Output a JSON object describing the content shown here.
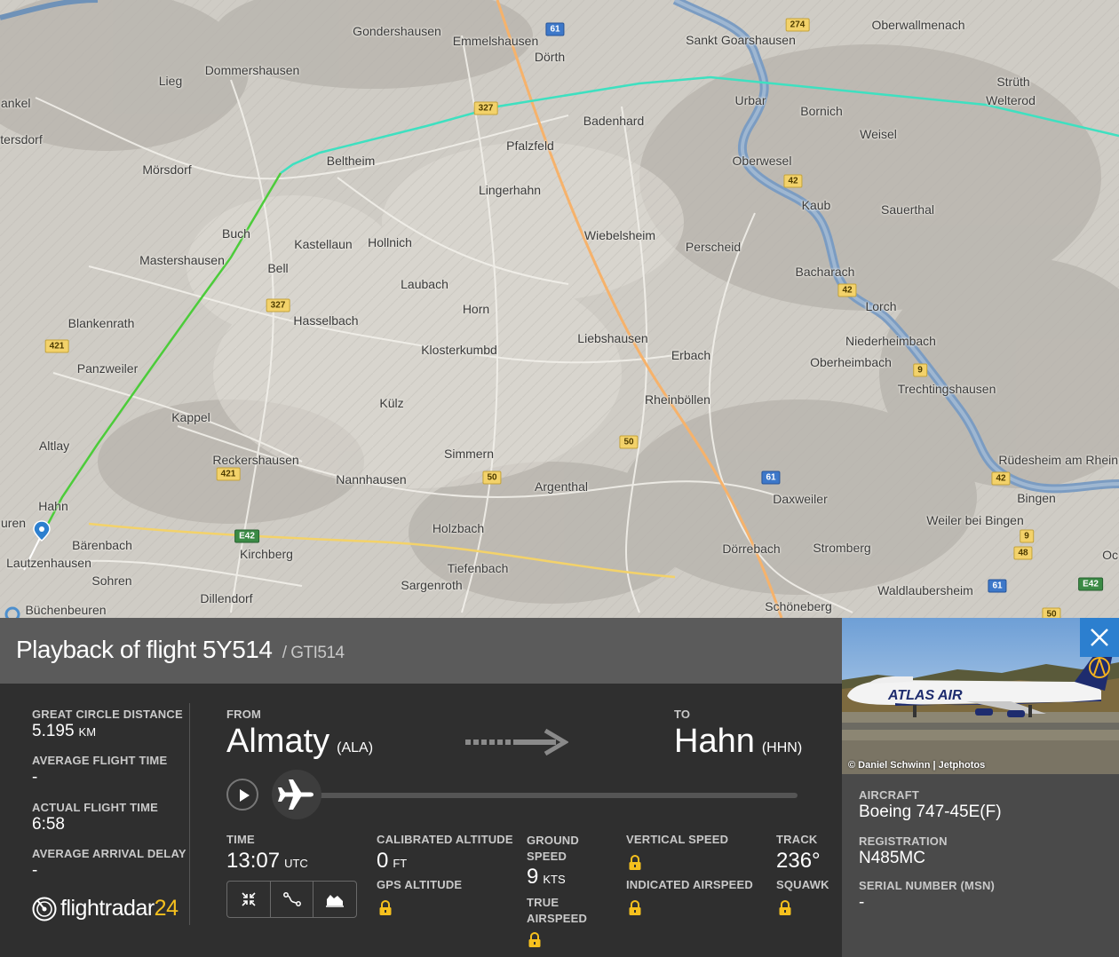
{
  "map": {
    "towns": [
      {
        "name": "Gondershausen"
      },
      {
        "name": "Emmelshausen"
      },
      {
        "name": "Dörth"
      },
      {
        "name": "Sankt Goarshausen"
      },
      {
        "name": "Oberwallmenach"
      },
      {
        "name": "Dommershausen"
      },
      {
        "name": "Lieg"
      },
      {
        "name": "ankel"
      },
      {
        "name": "tersdorf"
      },
      {
        "name": "Mörsdorf"
      },
      {
        "name": "Beltheim"
      },
      {
        "name": "Pfalzfeld"
      },
      {
        "name": "Badenhard"
      },
      {
        "name": "Urbar"
      },
      {
        "name": "Bornich"
      },
      {
        "name": "Strüth"
      },
      {
        "name": "Welterod"
      },
      {
        "name": "Weisel"
      },
      {
        "name": "Oberwesel"
      },
      {
        "name": "Lingerhahn"
      },
      {
        "name": "Kaub"
      },
      {
        "name": "Sauerthal"
      },
      {
        "name": "Buch"
      },
      {
        "name": "Kastellaun"
      },
      {
        "name": "Hollnich"
      },
      {
        "name": "Wiebelsheim"
      },
      {
        "name": "Perscheid"
      },
      {
        "name": "Mastershausen"
      },
      {
        "name": "Bell"
      },
      {
        "name": "Laubach"
      },
      {
        "name": "Bacharach"
      },
      {
        "name": "Lorch"
      },
      {
        "name": "Horn"
      },
      {
        "name": "Blankenrath"
      },
      {
        "name": "Hasselbach"
      },
      {
        "name": "Liebshausen"
      },
      {
        "name": "Niederheimbach"
      },
      {
        "name": "Klosterkumbd"
      },
      {
        "name": "Erbach"
      },
      {
        "name": "Oberheimbach"
      },
      {
        "name": "Panzweiler"
      },
      {
        "name": "Trechtingshausen"
      },
      {
        "name": "Külz"
      },
      {
        "name": "Rheinböllen"
      },
      {
        "name": "Kappel"
      },
      {
        "name": "Altlay"
      },
      {
        "name": "Simmern"
      },
      {
        "name": "Rüdesheim am Rhein"
      },
      {
        "name": "Reckershausen"
      },
      {
        "name": "Nannhausen"
      },
      {
        "name": "Argenthal"
      },
      {
        "name": "Daxweiler"
      },
      {
        "name": "Bingen"
      },
      {
        "name": "Hahn"
      },
      {
        "name": "uren"
      },
      {
        "name": "Holzbach"
      },
      {
        "name": "Weiler bei Bingen"
      },
      {
        "name": "Bärenbach"
      },
      {
        "name": "Kirchberg"
      },
      {
        "name": "Dörrebach"
      },
      {
        "name": "Stromberg"
      },
      {
        "name": "Lautzenhausen"
      },
      {
        "name": "Tiefenbach"
      },
      {
        "name": "Sohren"
      },
      {
        "name": "Sargenroth"
      },
      {
        "name": "Dillendorf"
      },
      {
        "name": "Waldlaubersheim"
      },
      {
        "name": "Büchenbeuren"
      },
      {
        "name": "Schöneberg"
      },
      {
        "name": "Oc"
      }
    ],
    "roads": [
      {
        "label": "61",
        "kind": "a"
      },
      {
        "label": "274",
        "kind": "b"
      },
      {
        "label": "327",
        "kind": "b"
      },
      {
        "label": "42",
        "kind": "b"
      },
      {
        "label": "42",
        "kind": "b"
      },
      {
        "label": "327",
        "kind": "b"
      },
      {
        "label": "421",
        "kind": "b"
      },
      {
        "label": "9",
        "kind": "b"
      },
      {
        "label": "50",
        "kind": "b"
      },
      {
        "label": "421",
        "kind": "b"
      },
      {
        "label": "50",
        "kind": "b"
      },
      {
        "label": "61",
        "kind": "a"
      },
      {
        "label": "42",
        "kind": "b"
      },
      {
        "label": "E42",
        "kind": "e"
      },
      {
        "label": "9",
        "kind": "b"
      },
      {
        "label": "48",
        "kind": "b"
      },
      {
        "label": "61",
        "kind": "a"
      },
      {
        "label": "E42",
        "kind": "e"
      },
      {
        "label": "50",
        "kind": "b"
      }
    ]
  },
  "flight": {
    "title": "Playback of flight 5Y514",
    "subtitle": "/ GTI514",
    "great_circle_distance_label": "GREAT CIRCLE DISTANCE",
    "great_circle_distance": "5.195",
    "great_circle_distance_unit": "KM",
    "avg_flight_time_label": "AVERAGE FLIGHT TIME",
    "avg_flight_time": "-",
    "actual_flight_time_label": "ACTUAL FLIGHT TIME",
    "actual_flight_time": "6:58",
    "avg_arrival_delay_label": "AVERAGE ARRIVAL DELAY",
    "avg_arrival_delay": "-",
    "from_label": "FROM",
    "from_city": "Almaty",
    "from_code": "(ALA)",
    "to_label": "TO",
    "to_city": "Hahn",
    "to_code": "(HHN)",
    "time_label": "TIME",
    "time": "13:07",
    "time_unit": "UTC",
    "cal_alt_label": "CALIBRATED ALTITUDE",
    "cal_alt": "0",
    "cal_alt_unit": "FT",
    "gps_alt_label": "GPS ALTITUDE",
    "ground_speed_label": "GROUND SPEED",
    "ground_speed": "9",
    "ground_speed_unit": "KTS",
    "true_airspeed_label": "TRUE AIRSPEED",
    "vertical_speed_label": "VERTICAL SPEED",
    "indicated_airspeed_label": "INDICATED AIRSPEED",
    "track_label": "TRACK",
    "track": "236°",
    "squawk_label": "SQUAWK",
    "playback_progress": 0.0
  },
  "aircraft": {
    "photo_credit": "© Daniel Schwinn | Jetphotos",
    "livery_text": "ATLAS AIR",
    "aircraft_label": "AIRCRAFT",
    "aircraft": "Boeing 747-45E(F)",
    "registration_label": "REGISTRATION",
    "registration": "N485MC",
    "serial_label": "SERIAL NUMBER (MSN)",
    "serial": "-"
  },
  "logo": {
    "word": "flightradar",
    "num": "24"
  },
  "colors": {
    "accent_blue": "#2c7fcf",
    "track_green": "#4ccc3a",
    "track_teal": "#3ee0c0",
    "logo_yellow": "#f5c01e"
  }
}
